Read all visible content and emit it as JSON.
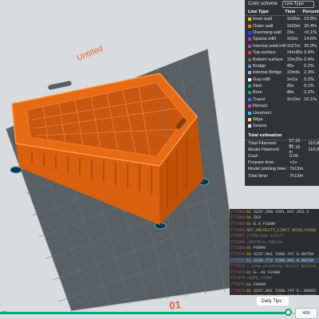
{
  "scene": {
    "plate_name": "Untitled",
    "plate_number": "01"
  },
  "color_scheme": {
    "title": "Color scheme",
    "dropdown_value": "Line Type",
    "columns": [
      "Line Type",
      "Time",
      "Percent"
    ],
    "line_types": [
      {
        "name": "Inner wall",
        "time": "1h26m",
        "percent": "19.8%",
        "color": "#f0c419"
      },
      {
        "name": "Outer wall",
        "time": "1h29m",
        "percent": "20.4%",
        "color": "#ff7a00"
      },
      {
        "name": "Overhang wall",
        "time": "23s",
        "percent": "<0.1%",
        "color": "#1e44ff"
      },
      {
        "name": "Sparse infill",
        "time": "1h3m",
        "percent": "14.6%",
        "color": "#b03cc8"
      },
      {
        "name": "Internal solid infill",
        "time": "1h27m",
        "percent": "20.0%",
        "color": "#b347b3"
      },
      {
        "name": "Top surface",
        "time": "14m36s",
        "percent": "3.4%",
        "color": "#e8343c"
      },
      {
        "name": "Bottom surface",
        "time": "10m25s",
        "percent": "2.4%",
        "color": "#707070"
      },
      {
        "name": "Bridge",
        "time": "48s",
        "percent": "0.2%",
        "color": "#5a8fd0"
      },
      {
        "name": "Internal Bridge",
        "time": "10m6s",
        "percent": "2.3%",
        "color": "#8fb3e0"
      },
      {
        "name": "Gap infill",
        "time": "1m1s",
        "percent": "0.2%",
        "color": "#ffffff"
      },
      {
        "name": "Skirt",
        "time": "26s",
        "percent": "0.1%",
        "color": "#00b0b0"
      },
      {
        "name": "Brim",
        "time": "48s",
        "percent": "0.2%",
        "color": "#1aa36b"
      },
      {
        "name": "Travel",
        "time": "1h10m",
        "percent": "16.1%",
        "color": "#2f7fe8"
      }
    ],
    "extra_types": [
      {
        "name": "Retract",
        "color": "#d83ccf"
      },
      {
        "name": "Unretract",
        "color": "#38c8e8"
      },
      {
        "name": "Wipe",
        "color": "#f0e060"
      },
      {
        "name": "Seams",
        "color": "#e8e8e8"
      }
    ]
  },
  "estimation": {
    "title": "Total estimation",
    "rows": [
      {
        "label": "Total Filament:",
        "value": "37.15 m",
        "extra": "110.8"
      },
      {
        "label": "Model Filament:",
        "value": "37.15 m",
        "extra": "110.8"
      },
      {
        "label": "Cost:",
        "value": "0.00",
        "extra": ""
      },
      {
        "label": "Prepare time:",
        "value": "<1s",
        "extra": ""
      },
      {
        "label": "Model printing time:",
        "value": "7h13m",
        "extra": ""
      },
      {
        "label": "Total time:",
        "value": "7h13m",
        "extra": ""
      }
    ]
  },
  "gcode": {
    "lines": [
      {
        "num": "777363",
        "text": "G1 X237.299 Y201.037 Z63.3",
        "current": false
      },
      {
        "num": "777364",
        "text": "G1 Z63",
        "current": false
      },
      {
        "num": "777365",
        "text": "G1 E.6 F1800",
        "current": false
      },
      {
        "num": "777366",
        "text": "SET_VELOCITY_LIMIT ACCEL=2500",
        "current": false
      },
      {
        "num": "777367",
        "text": ";TYPE:Gap infill",
        "current": false
      },
      {
        "num": "777368",
        "text": ";WIDTH:0.298139",
        "current": false
      },
      {
        "num": "777369",
        "text": "G1 F6000",
        "current": false
      },
      {
        "num": "777370",
        "text": "G1 X237.061 Y200.747 E.00758",
        "current": false
      },
      {
        "num": "777371",
        "text": "G1 X236.772 Y200.501 E.00768",
        "current": true
      },
      {
        "num": "777372",
        "text": "; stop printing object majnoo_crate_1",
        "current": false
      },
      {
        "num": "777373",
        "text": "G1 E-.42 F2400",
        "current": false
      },
      {
        "num": "777374",
        "text": ";WIPE_START",
        "current": false
      },
      {
        "num": "777375",
        "text": "G1 F6000",
        "current": false
      },
      {
        "num": "777376",
        "text": "G1 X237.061 Y200.747 E-.09055",
        "current": false
      },
      {
        "num": "777377",
        "text": "G1 X237.299 Y201.037 E-.08945",
        "current": false
      },
      {
        "num": "777378",
        "text": ";WIPE_END",
        "current": false
      }
    ]
  },
  "daily_tips": {
    "label": "Daily Tips :"
  },
  "slider": {
    "current_value": "409",
    "left_glyph": "−",
    "progress": 0.965
  }
}
